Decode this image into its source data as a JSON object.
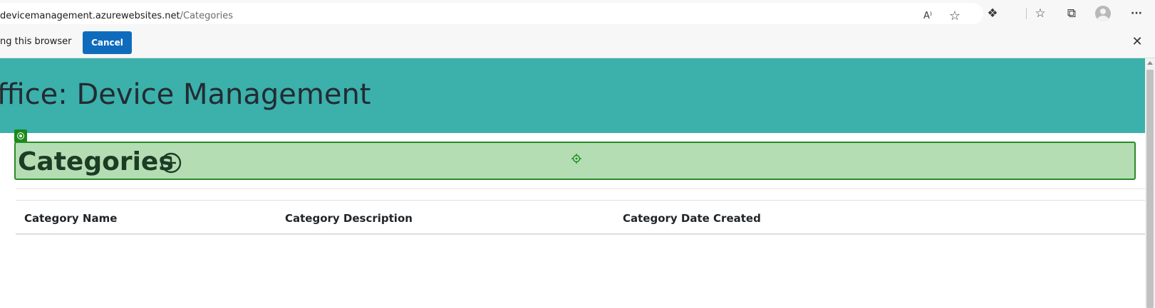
{
  "browser": {
    "url_host": "devicemanagement.azurewebsites.net",
    "url_path": "/Categories",
    "toolbar_icons": [
      "read-aloud-icon",
      "add-favorite-icon",
      "extensions-icon",
      "favorites-icon",
      "collections-icon",
      "profile-icon",
      "more-icon"
    ],
    "read_aloud_glyph": "A⁾",
    "add_favorite_glyph": "☆",
    "extensions_glyph": "❖",
    "favorites_glyph": "☆",
    "collections_glyph": "⧉",
    "more_glyph": "···"
  },
  "infobar": {
    "message": "ng this browser",
    "cancel_label": "Cancel",
    "close_glyph": "✕"
  },
  "page": {
    "banner_title": "ffice: Device Management",
    "banner_color": "#3cb0aa",
    "section_title": "Categories",
    "highlight_color": "#b4ddb3",
    "table": {
      "headers": [
        "Category Name",
        "Category Description",
        "Category Date Created"
      ],
      "rows": []
    }
  }
}
